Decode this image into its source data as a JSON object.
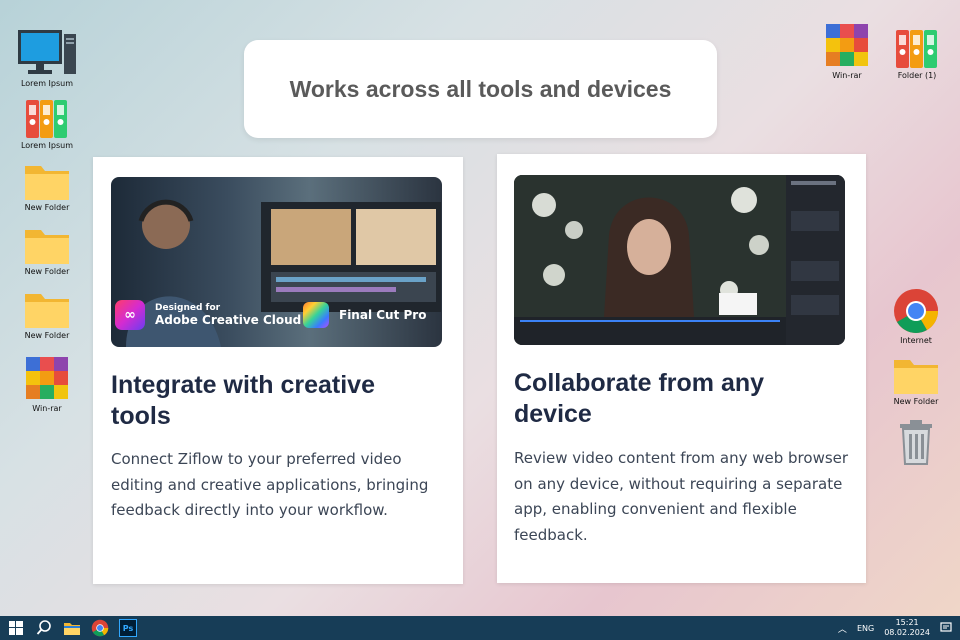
{
  "desktop": {
    "left_icons": [
      {
        "label": "Lorem Ipsum",
        "icon": "computer-icon"
      },
      {
        "label": "Lorem Ipsum",
        "icon": "binders-icon"
      },
      {
        "label": "New Folder",
        "icon": "folder-icon"
      },
      {
        "label": "New Folder",
        "icon": "folder-icon"
      },
      {
        "label": "New Folder",
        "icon": "folder-icon"
      },
      {
        "label": "Win-rar",
        "icon": "winrar-icon"
      }
    ],
    "top_right_icons": [
      {
        "label": "Win-rar",
        "icon": "winrar-icon"
      },
      {
        "label": "Folder (1)",
        "icon": "binders-icon"
      }
    ],
    "right_icons": [
      {
        "label": "Internet",
        "icon": "chrome-icon"
      },
      {
        "label": "New Folder",
        "icon": "folder-icon"
      },
      {
        "label": "",
        "icon": "recycle-bin-icon"
      }
    ]
  },
  "headline": "Works across all tools and devices",
  "cards": [
    {
      "title": "Integrate with creative tools",
      "body": "Connect Ziflow to your preferred video editing and creative applications, bringing feedback directly into your workflow.",
      "badge_small": "Designed for",
      "badge_main": "Adobe Creative Cloud",
      "badge_second": "Final Cut Pro"
    },
    {
      "title": "Collaborate from any device",
      "body": "Review video content from any web browser on any device, without requiring a separate app, enabling convenient and flexible feedback."
    }
  ],
  "taskbar": {
    "apps": [
      "windows-start-icon",
      "search-icon",
      "file-explorer-icon",
      "chrome-icon",
      "photoshop-icon"
    ],
    "ps_label": "Ps",
    "lang": "ENG",
    "time": "15:21",
    "date": "08.02.2024"
  },
  "colors": {
    "taskbar": "#173d57",
    "title": "#1f2a44",
    "body": "#3c4656",
    "headline": "#5a5a5a"
  }
}
